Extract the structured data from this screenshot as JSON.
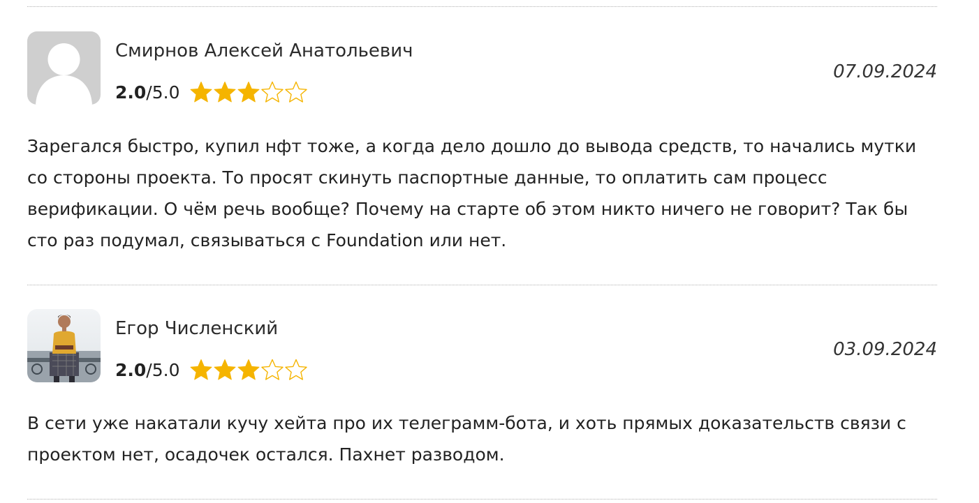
{
  "reviews": [
    {
      "author": "Смирнов Алексей Анатольевич",
      "rating_value": "2.0",
      "rating_max": "/5.0",
      "stars_filled": 3,
      "stars_total": 5,
      "date": "07.09.2024",
      "avatar": "default-user-icon",
      "text": "Зарегался быстро, купил нфт тоже, а когда дело дошло до вывода средств, то начались мутки со стороны проекта. То просят скинуть паспортные данные, то оплатить сам процесс верификации. О чём речь вообще? Почему на старте об этом никто ничего не говорит? Так бы сто раз подумал, связываться с Foundation или нет."
    },
    {
      "author": "Егор Численский",
      "rating_value": "2.0",
      "rating_max": "/5.0",
      "stars_filled": 3,
      "stars_total": 5,
      "date": "03.09.2024",
      "avatar": "user-photo",
      "text": "В сети уже накатали кучу хейта про их телеграмм-бота, и хоть прямых доказательств связи с проектом нет, осадочек остался. Пахнет разводом."
    }
  ],
  "colors": {
    "star": "#F5B400",
    "divider": "#B0B0B0",
    "avatar_bg": "#CFCFCF"
  }
}
